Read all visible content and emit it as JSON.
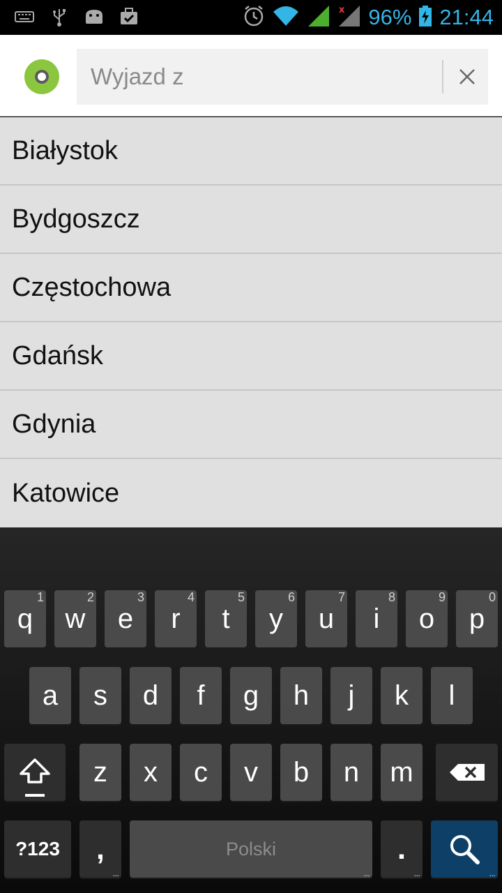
{
  "status_bar": {
    "battery": "96%",
    "time": "21:44",
    "left_icons": [
      "keyboard-icon",
      "usb-icon",
      "android-icon",
      "briefcase-check-icon"
    ],
    "right_icons": [
      "alarm-icon",
      "wifi-icon",
      "signal-icon",
      "signal-nodata-icon",
      "battery-charging-icon"
    ],
    "accent": "#33b5e5"
  },
  "search": {
    "placeholder": "Wyjazd z",
    "value": "",
    "origin_color": "#8cc63f"
  },
  "suggestions": [
    "Białystok",
    "Bydgoszcz",
    "Częstochowa",
    "Gdańsk",
    "Gdynia",
    "Katowice"
  ],
  "keyboard": {
    "row1": [
      {
        "k": "q",
        "h": "1"
      },
      {
        "k": "w",
        "h": "2"
      },
      {
        "k": "e",
        "h": "3"
      },
      {
        "k": "r",
        "h": "4"
      },
      {
        "k": "t",
        "h": "5"
      },
      {
        "k": "y",
        "h": "6"
      },
      {
        "k": "u",
        "h": "7"
      },
      {
        "k": "i",
        "h": "8"
      },
      {
        "k": "o",
        "h": "9"
      },
      {
        "k": "p",
        "h": "0"
      }
    ],
    "row2": [
      "a",
      "s",
      "d",
      "f",
      "g",
      "h",
      "j",
      "k",
      "l"
    ],
    "row3": [
      "z",
      "x",
      "c",
      "v",
      "b",
      "n",
      "m"
    ],
    "symbols_label": "?123",
    "comma_label": ",",
    "space_label": "Polski",
    "period_label": ".",
    "search_color": "#0e3f66"
  }
}
